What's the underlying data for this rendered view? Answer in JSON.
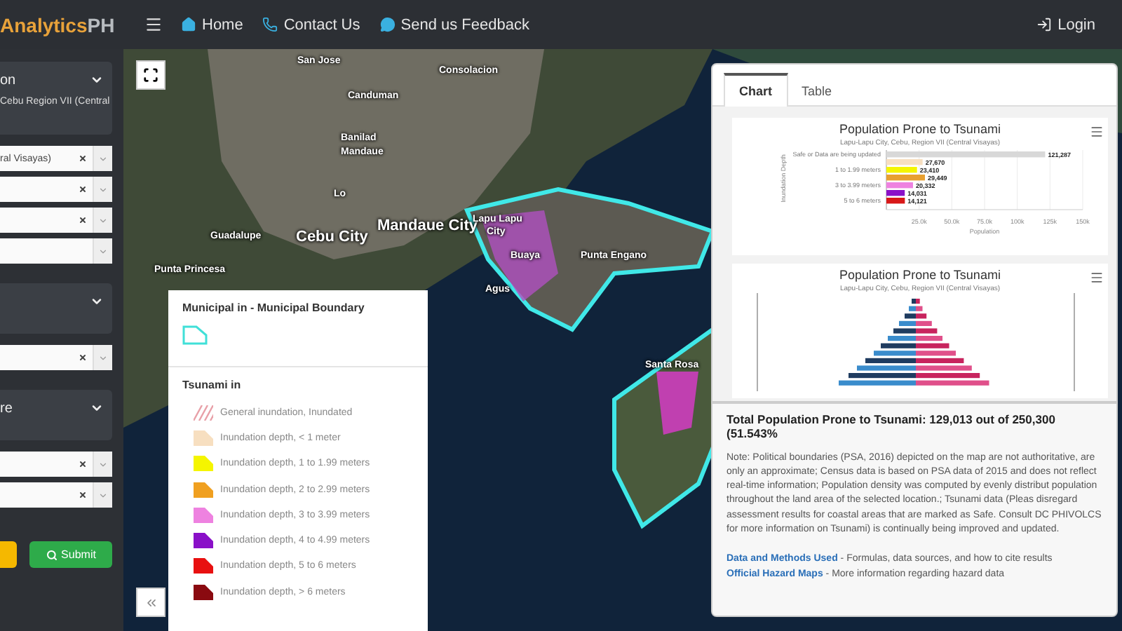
{
  "navbar": {
    "brand": {
      "accent": "Analytics",
      "rest": "PH"
    },
    "links": [
      {
        "label": "Home"
      },
      {
        "label": "Contact Us"
      },
      {
        "label": "Send us Feedback"
      }
    ],
    "login": "Login"
  },
  "sidebar": {
    "sections": [
      {
        "header": "on",
        "expanded": true,
        "text": "Cebu Region VII (Central",
        "selects": [
          {
            "value": "ral Visayas)",
            "clearable": true
          },
          {
            "clearable": true
          },
          {
            "clearable": true
          },
          {
            "clearable": false
          }
        ]
      },
      {
        "expanded": true,
        "selects": [
          {
            "clearable": true
          }
        ]
      },
      {
        "header": "re",
        "expanded": true,
        "selects": [
          {
            "clearable": true
          },
          {
            "clearable": true
          }
        ]
      }
    ],
    "submit": "Submit"
  },
  "map": {
    "labels": [
      {
        "text": "San Jose",
        "kind": "small"
      },
      {
        "text": "Consolacion",
        "kind": "small"
      },
      {
        "text": "Canduman",
        "kind": "small"
      },
      {
        "text": "Banilad",
        "kind": "small"
      },
      {
        "text": "Mandaue",
        "kind": "small"
      },
      {
        "text": "Lo",
        "kind": "small"
      },
      {
        "text": "Mandaue City",
        "kind": "city"
      },
      {
        "text": "Cebu City",
        "kind": "city"
      },
      {
        "text": "Lapu Lapu",
        "kind": "small"
      },
      {
        "text": "City",
        "kind": "small"
      },
      {
        "text": "Guadalupe",
        "kind": "small"
      },
      {
        "text": "Buaya",
        "kind": "small"
      },
      {
        "text": "Punta Engano",
        "kind": "small"
      },
      {
        "text": "Punta Princesa",
        "kind": "small"
      },
      {
        "text": "Agus",
        "kind": "small"
      },
      {
        "text": "Santa Rosa",
        "kind": "small"
      }
    ]
  },
  "legend": {
    "boundary_title": "Municipal in - Municipal Boundary",
    "tsunami_title": "Tsunami in",
    "items": [
      {
        "label": "General inundation, Inundated",
        "kind": "hatch",
        "color": "#e8a0a8"
      },
      {
        "label": "Inundation depth, < 1 meter",
        "kind": "fill",
        "color": "#f7dfc0"
      },
      {
        "label": "Inundation depth, 1 to 1.99 meters",
        "kind": "fill",
        "color": "#f5f500"
      },
      {
        "label": "Inundation depth, 2 to 2.99 meters",
        "kind": "fill",
        "color": "#f0a020"
      },
      {
        "label": "Inundation depth, 3 to 3.99 meters",
        "kind": "fill",
        "color": "#ee82e0"
      },
      {
        "label": "Inundation depth, 4 to 4.99 meters",
        "kind": "fill",
        "color": "#8a10c8"
      },
      {
        "label": "Inundation depth, 5 to 6 meters",
        "kind": "fill",
        "color": "#e81010"
      },
      {
        "label": "Inundation depth, > 6 meters",
        "kind": "fill",
        "color": "#8a0a10"
      }
    ]
  },
  "panel": {
    "tabs": [
      {
        "label": "Chart",
        "selected": true
      },
      {
        "label": "Table",
        "selected": false
      }
    ],
    "bar_chart": {
      "subtitle": "Lapu-Lapu City, Cebu, Region VII (Central Visayas)",
      "chart_data": {
        "type": "bar",
        "orientation": "horizontal",
        "title": "Population Prone to Tsunami",
        "xlabel": "Population",
        "ylabel": "Inundation Depth",
        "categories": [
          "Safe or Data are being updated",
          null,
          "1 to 1.99 meters",
          null,
          "3 to 3.99 meters",
          null,
          "5 to 6 meters"
        ],
        "series": [
          {
            "values": [
              121287,
              27670,
              23410,
              29449,
              20332,
              14031,
              14121
            ]
          }
        ],
        "xticks": [
          {
            "value": 25000,
            "label": "25.0k"
          },
          {
            "value": 50000,
            "label": "50.0k"
          },
          {
            "value": 75000,
            "label": "75.0k"
          },
          {
            "value": 100000,
            "label": "100k"
          },
          {
            "value": 125000,
            "label": "125k"
          },
          {
            "value": 150000,
            "label": "150k"
          }
        ],
        "xlim": [
          0,
          150000
        ],
        "grid": true,
        "value_labels": [
          "121,287",
          "27,670",
          "23,410",
          "29,449",
          "20,332",
          "14,031",
          "14,121"
        ]
      }
    },
    "pyramid_chart": {
      "title": "Population Prone to Tsunami",
      "subtitle": "Lapu-Lapu City, Cebu, Region VII (Central Visayas)"
    },
    "total": "Total Population Prone to Tsunami: 129,013 out of 250,300 (51.543%",
    "note": "Note: Political boundaries (PSA, 2016) depicted on the map are not authoritative, are only an approximate; Census data is based on PSA data of 2015 and does not reflect real-time information; Population density was computed by evenly distribut population throughout the land area of the selected location.; Tsunami data (Pleas disregard assessment results for coastal areas that are marked as Safe. Consult DC PHIVOLCS for more information on Tsunami) is continually being improved and updated.",
    "links": [
      {
        "link": "Data and Methods Used",
        "text": " - Formulas, data sources, and how to cite results"
      },
      {
        "link": "Official Hazard Maps",
        "text": " - More information regarding hazard data"
      }
    ]
  }
}
